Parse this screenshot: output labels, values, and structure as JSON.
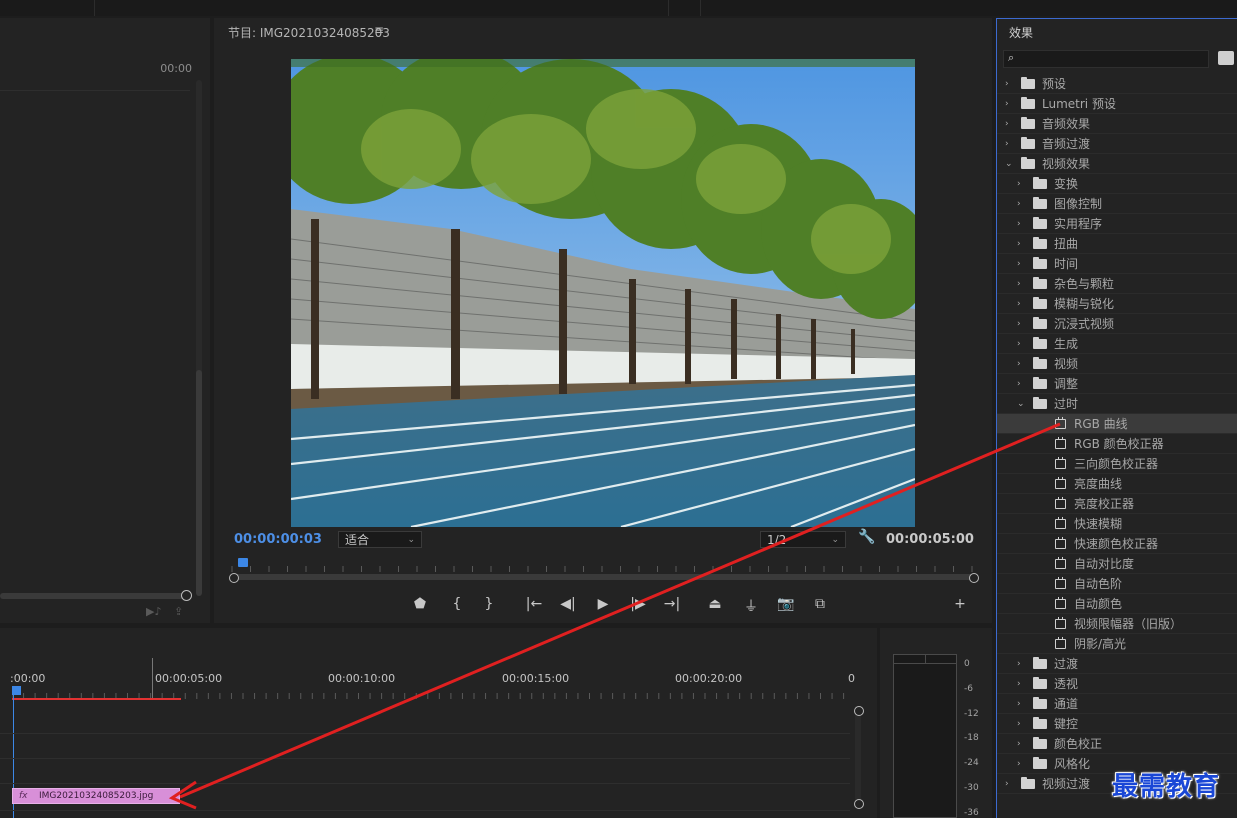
{
  "source_monitor": {
    "timecode": "00:00"
  },
  "program_monitor": {
    "title": "节目: IMG20210324085203",
    "menu_glyph": "≡",
    "current_timecode": "00:00:00:03",
    "fit": "适合",
    "resolution": "1/2",
    "duration": "00:00:05:00",
    "controls": [
      "add-marker",
      "mark-in",
      "mark-out",
      "go-to-in",
      "step-back",
      "play",
      "step-forward",
      "go-to-out",
      "lift",
      "extract",
      "export-frame",
      "compare"
    ]
  },
  "effects_panel": {
    "title": "效果",
    "search_placeholder": "",
    "tree": [
      {
        "label": "预设",
        "type": "folder",
        "level": 0,
        "expanded": false
      },
      {
        "label": "Lumetri 预设",
        "type": "folder",
        "level": 0,
        "expanded": false
      },
      {
        "label": "音频效果",
        "type": "folder",
        "level": 0,
        "expanded": false
      },
      {
        "label": "音频过渡",
        "type": "folder",
        "level": 0,
        "expanded": false
      },
      {
        "label": "视频效果",
        "type": "folder",
        "level": 0,
        "expanded": true
      },
      {
        "label": "变换",
        "type": "folder",
        "level": 1,
        "expanded": false
      },
      {
        "label": "图像控制",
        "type": "folder",
        "level": 1,
        "expanded": false
      },
      {
        "label": "实用程序",
        "type": "folder",
        "level": 1,
        "expanded": false
      },
      {
        "label": "扭曲",
        "type": "folder",
        "level": 1,
        "expanded": false
      },
      {
        "label": "时间",
        "type": "folder",
        "level": 1,
        "expanded": false
      },
      {
        "label": "杂色与颗粒",
        "type": "folder",
        "level": 1,
        "expanded": false
      },
      {
        "label": "模糊与锐化",
        "type": "folder",
        "level": 1,
        "expanded": false
      },
      {
        "label": "沉浸式视频",
        "type": "folder",
        "level": 1,
        "expanded": false
      },
      {
        "label": "生成",
        "type": "folder",
        "level": 1,
        "expanded": false
      },
      {
        "label": "视频",
        "type": "folder",
        "level": 1,
        "expanded": false
      },
      {
        "label": "调整",
        "type": "folder",
        "level": 1,
        "expanded": false
      },
      {
        "label": "过时",
        "type": "folder",
        "level": 1,
        "expanded": true
      },
      {
        "label": "RGB 曲线",
        "type": "effect",
        "level": 2,
        "selected": true
      },
      {
        "label": "RGB 颜色校正器",
        "type": "effect",
        "level": 2
      },
      {
        "label": "三向颜色校正器",
        "type": "effect",
        "level": 2
      },
      {
        "label": "亮度曲线",
        "type": "effect",
        "level": 2
      },
      {
        "label": "亮度校正器",
        "type": "effect",
        "level": 2
      },
      {
        "label": "快速模糊",
        "type": "effect",
        "level": 2
      },
      {
        "label": "快速颜色校正器",
        "type": "effect",
        "level": 2
      },
      {
        "label": "自动对比度",
        "type": "effect",
        "level": 2
      },
      {
        "label": "自动色阶",
        "type": "effect",
        "level": 2
      },
      {
        "label": "自动颜色",
        "type": "effect",
        "level": 2
      },
      {
        "label": "视频限幅器（旧版）",
        "type": "effect",
        "level": 2
      },
      {
        "label": "阴影/高光",
        "type": "effect",
        "level": 2
      },
      {
        "label": "过渡",
        "type": "folder",
        "level": 1,
        "expanded": false
      },
      {
        "label": "透视",
        "type": "folder",
        "level": 1,
        "expanded": false
      },
      {
        "label": "通道",
        "type": "folder",
        "level": 1,
        "expanded": false
      },
      {
        "label": "键控",
        "type": "folder",
        "level": 1,
        "expanded": false
      },
      {
        "label": "颜色校正",
        "type": "folder",
        "level": 1,
        "expanded": false
      },
      {
        "label": "风格化",
        "type": "folder",
        "level": 1,
        "expanded": false
      },
      {
        "label": "视频过渡",
        "type": "folder",
        "level": 0,
        "expanded": false
      }
    ]
  },
  "timeline": {
    "labels": [
      ":00:00",
      "00:00:05:00",
      "00:00:10:00",
      "00:00:15:00",
      "00:00:20:00",
      "0"
    ],
    "clip": {
      "fx_label": "fx",
      "name": "IMG20210324085203.jpg"
    }
  },
  "audio_meter": {
    "scale": [
      "0",
      "-6",
      "-12",
      "-18",
      "-24",
      "-30",
      "-36"
    ]
  },
  "watermark": "最需教育",
  "colors": {
    "accent_blue": "#3c87e6",
    "clip_pink": "#d88fd8",
    "annotation_red": "#e02020",
    "playhead_red": "#e23232"
  }
}
